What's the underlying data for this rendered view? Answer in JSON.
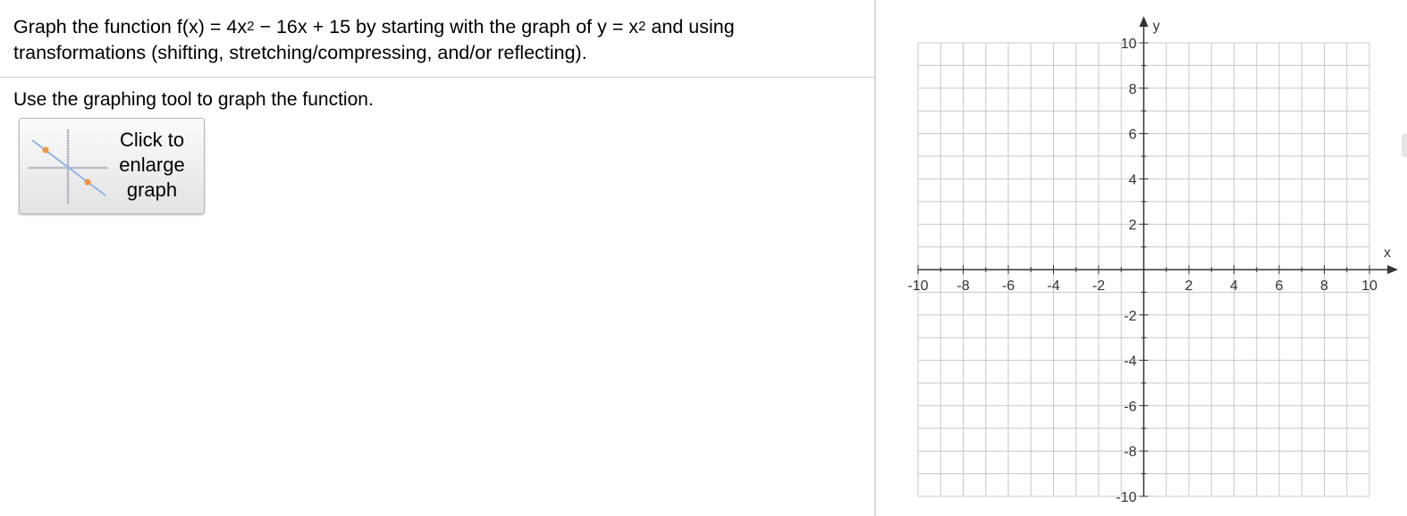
{
  "question": {
    "line1_prefix": "Graph the function f(x) = 4x",
    "exp1": "2",
    "line1_mid": " − 16x + 15 by starting with the graph of y = x",
    "exp2": "2",
    "line1_suffix": " and using",
    "line2": "transformations (shifting, stretching/compressing, and/or reflecting)."
  },
  "instruction": "Use the graphing tool to graph the function.",
  "enlarge_button": {
    "line1": "Click to",
    "line2": "enlarge",
    "line3": "graph",
    "thumb_icon": "line-graph-thumbnail-icon"
  },
  "graph": {
    "x_axis_label": "x",
    "y_axis_label": "y",
    "x_range": [
      -10,
      10
    ],
    "y_range": [
      -10,
      10
    ],
    "grid_step": 1,
    "label_step": 2,
    "x_tick_labels": [
      "-10",
      "-8",
      "-6",
      "-4",
      "-2",
      "2",
      "4",
      "6",
      "8",
      "10"
    ],
    "y_tick_labels": [
      "10",
      "8",
      "6",
      "4",
      "2",
      "-2",
      "-4",
      "-6",
      "-8",
      "-10"
    ],
    "grid_color": "#c8c8c8",
    "axis_color": "#333333"
  },
  "colors": {
    "thumb_line": "#8fb4e6",
    "thumb_point": "#f0963c"
  }
}
